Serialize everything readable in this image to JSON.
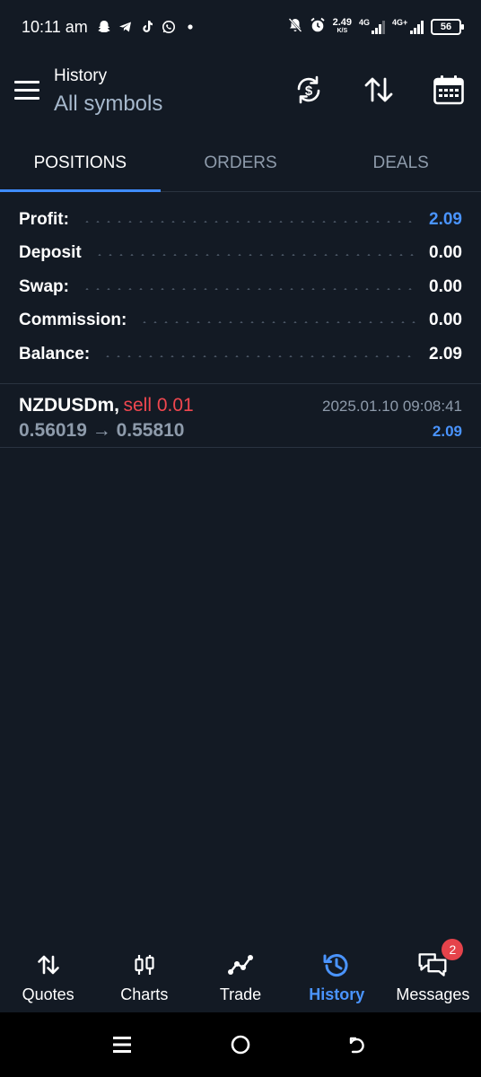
{
  "status_bar": {
    "time": "10:11 am",
    "net_speed_value": "2.49",
    "net_speed_unit": "K/S",
    "signal1_tag": "4G",
    "signal2_tag": "4G+",
    "battery": "56"
  },
  "app_bar": {
    "title": "History",
    "subtitle": "All symbols"
  },
  "tabs": [
    {
      "label": "POSITIONS",
      "active": true
    },
    {
      "label": "ORDERS",
      "active": false
    },
    {
      "label": "DEALS",
      "active": false
    }
  ],
  "summary": {
    "profit_label": "Profit:",
    "profit_value": "2.09",
    "deposit_label": "Deposit",
    "deposit_value": "0.00",
    "swap_label": "Swap:",
    "swap_value": "0.00",
    "commission_label": "Commission:",
    "commission_value": "0.00",
    "balance_label": "Balance:",
    "balance_value": "2.09"
  },
  "position": {
    "symbol": "NZDUSDm,",
    "side": "sell 0.01",
    "time": "2025.01.10 09:08:41",
    "prices": "0.56019 → 0.55810",
    "profit": "2.09"
  },
  "bottom_nav": {
    "quotes": "Quotes",
    "charts": "Charts",
    "trade": "Trade",
    "history": "History",
    "messages": "Messages",
    "messages_badge": "2"
  },
  "colors": {
    "background": "#131a24",
    "accent": "#3f8cff",
    "profit_blue": "#4a94ff",
    "sell_red": "#f0474f",
    "muted": "#8e9bab"
  }
}
